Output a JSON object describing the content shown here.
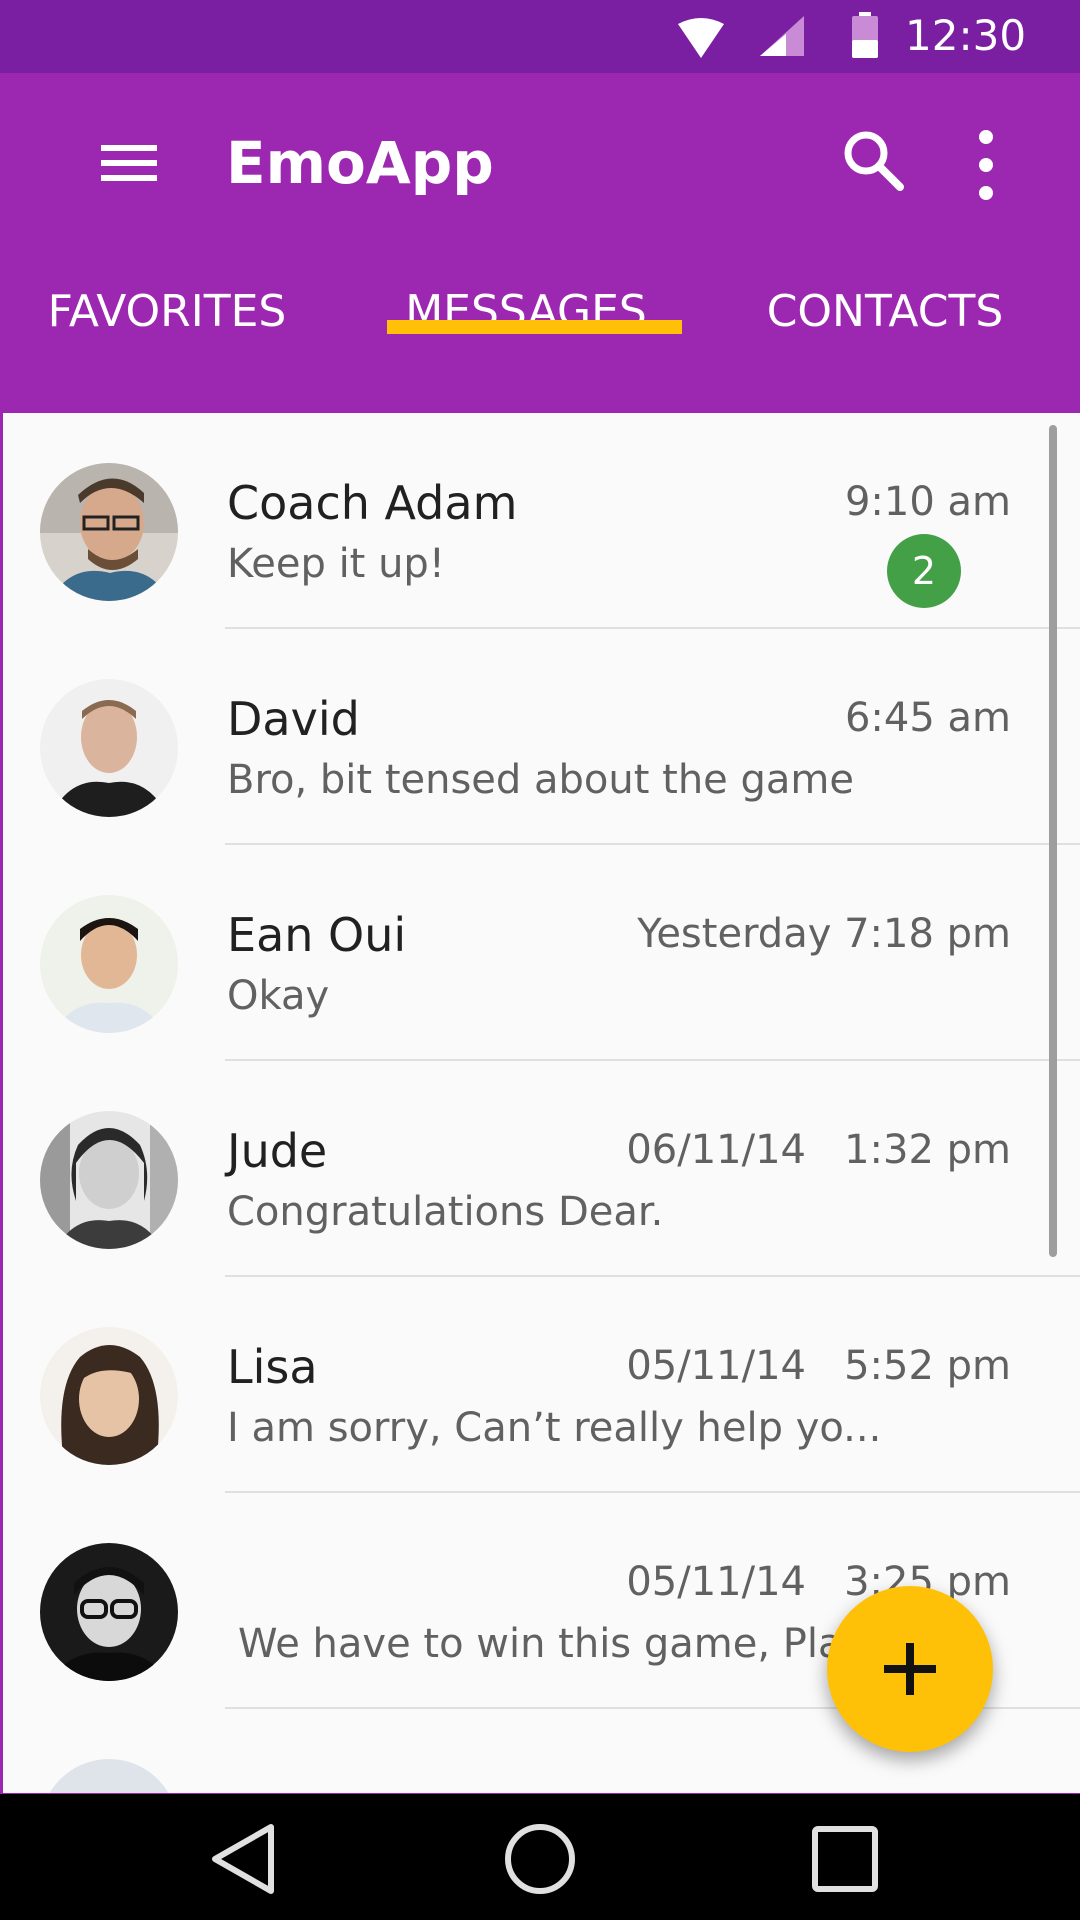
{
  "status_bar": {
    "time": "12:30"
  },
  "app_bar": {
    "title": "EmoApp"
  },
  "tabs": [
    {
      "label": "FAVORITES",
      "selected": false
    },
    {
      "label": "MESSAGES",
      "selected": true
    },
    {
      "label": "CONTACTS",
      "selected": false
    }
  ],
  "colors": {
    "primary": "#9c27b0",
    "primary_dark": "#7b1fa2",
    "accent": "#ffc107",
    "badge": "#43a047"
  },
  "conversations": [
    {
      "name": "Coach Adam",
      "time": "9:10 am",
      "preview": "Keep it up!",
      "unread": "2"
    },
    {
      "name": "David",
      "time": "6:45 am",
      "preview": "Bro, bit tensed about the game"
    },
    {
      "name": "Ean Oui",
      "time": "Yesterday 7:18 pm",
      "preview": "Okay"
    },
    {
      "name": "Jude",
      "time": "06/11/14   1:32 pm",
      "preview": "Congratulations Dear."
    },
    {
      "name": "Lisa",
      "time": "05/11/14   5:52 pm",
      "preview": "I am sorry, Can’t really help yo..."
    },
    {
      "name": "",
      "time": "05/11/14   3:25 pm",
      "preview": "We have to win this game, Pla..."
    }
  ],
  "fab": {
    "icon": "add-icon"
  }
}
